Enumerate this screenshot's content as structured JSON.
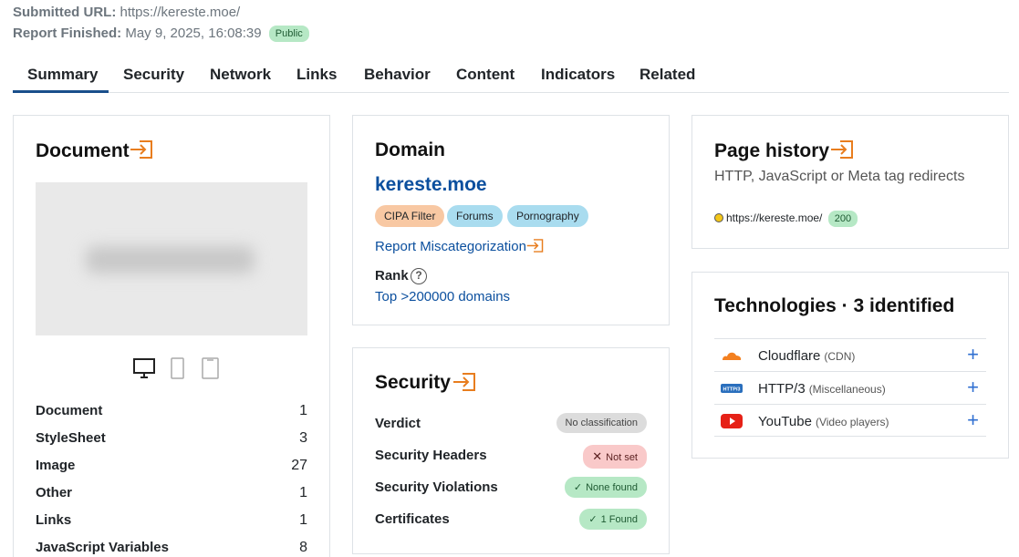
{
  "meta": {
    "submitted_label": "Submitted URL:",
    "submitted_url": "https://kereste.moe/",
    "finished_label": "Report Finished:",
    "finished_value": "May 9, 2025, 16:08:39",
    "visibility": "Public"
  },
  "tabs": [
    "Summary",
    "Security",
    "Network",
    "Links",
    "Behavior",
    "Content",
    "Indicators",
    "Related"
  ],
  "document": {
    "title": "Document",
    "rows": [
      {
        "label": "Document",
        "value": "1"
      },
      {
        "label": "StyleSheet",
        "value": "3"
      },
      {
        "label": "Image",
        "value": "27"
      },
      {
        "label": "Other",
        "value": "1"
      },
      {
        "label": "Links",
        "value": "1"
      },
      {
        "label": "JavaScript Variables",
        "value": "8"
      }
    ]
  },
  "domain": {
    "title": "Domain",
    "name": "kereste.moe",
    "categories": [
      {
        "label": "CIPA Filter",
        "color": "#f8c8a3"
      },
      {
        "label": "Forums",
        "color": "#a9dcef"
      },
      {
        "label": "Pornography",
        "color": "#a9dcef"
      }
    ],
    "report_link": "Report Miscategorization",
    "rank_label": "Rank",
    "rank_value": "Top >200000 domains"
  },
  "security": {
    "title": "Security",
    "rows": [
      {
        "label": "Verdict",
        "value": "No classification",
        "style": "gray"
      },
      {
        "label": "Security Headers",
        "value": "Not set",
        "style": "red"
      },
      {
        "label": "Security Violations",
        "value": "None found",
        "style": "green"
      },
      {
        "label": "Certificates",
        "value": "1 Found",
        "style": "green"
      }
    ]
  },
  "history": {
    "title": "Page history",
    "subtitle": "HTTP, JavaScript or Meta tag redirects",
    "url": "https://kereste.moe/",
    "status": "200"
  },
  "technologies": {
    "title": "Technologies · 3 identified",
    "items": [
      {
        "name": "Cloudflare",
        "category": "(CDN)",
        "icon": "cloudflare-icon"
      },
      {
        "name": "HTTP/3",
        "category": "(Miscellaneous)",
        "icon": "http3-icon"
      },
      {
        "name": "YouTube",
        "category": "(Video players)",
        "icon": "youtube-icon"
      }
    ]
  },
  "colors": {
    "accent": "#0b4f9e",
    "export_icon": "#e87d1e"
  }
}
